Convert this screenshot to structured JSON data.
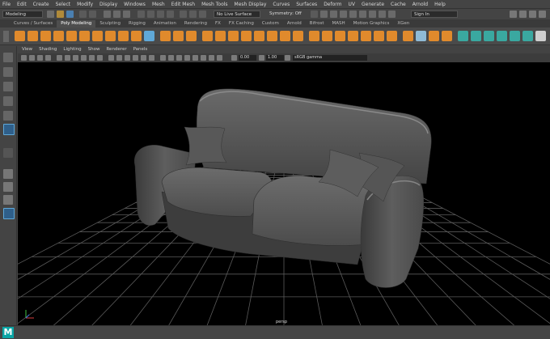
{
  "menubar": {
    "items": [
      "File",
      "Edit",
      "Create",
      "Select",
      "Modify",
      "Display",
      "Windows",
      "Mesh",
      "Edit Mesh",
      "Mesh Tools",
      "Mesh Display",
      "Curves",
      "Surfaces",
      "Deform",
      "UV",
      "Generate",
      "Cache",
      "Arnold",
      "Help"
    ]
  },
  "statusline": {
    "mode": "Modeling",
    "live_surface": "No Live Surface",
    "symmetry": "Symmetry: Off",
    "sign_in": "Sign In"
  },
  "shelf": {
    "tabs": [
      "Curves / Surfaces",
      "Poly Modeling",
      "Sculpting",
      "Rigging",
      "Animation",
      "Rendering",
      "FX",
      "FX Caching",
      "Custom",
      "Arnold",
      "Bifrost",
      "MASH",
      "Motion Graphics",
      "XGen"
    ],
    "active_tab": "Poly Modeling"
  },
  "panel": {
    "menus": [
      "View",
      "Shading",
      "Lighting",
      "Show",
      "Renderer",
      "Panels"
    ],
    "exposure": "0.00",
    "gamma": "1.00",
    "color_space": "sRGB gamma",
    "camera": "persp"
  },
  "logo": {
    "letter": "M"
  },
  "colors": {
    "accent": "#e08a2c",
    "highlight": "#5fa8d8",
    "viewport_bg": "#000000",
    "grid": "#5a5a5a"
  }
}
